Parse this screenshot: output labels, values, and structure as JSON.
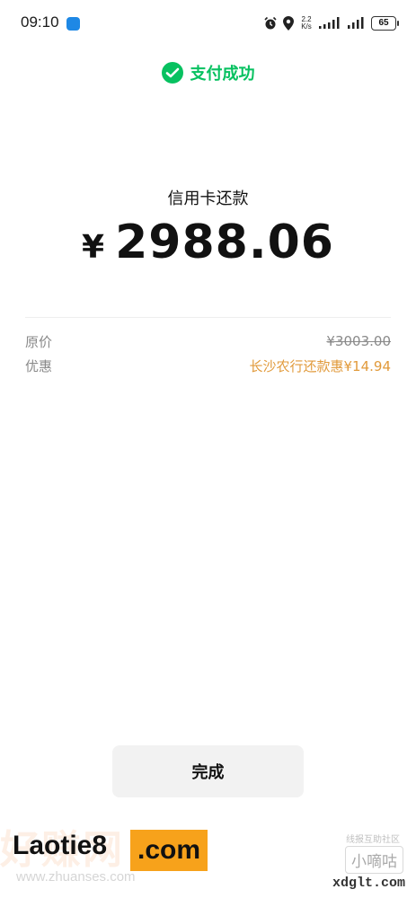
{
  "status": {
    "time": "09:10",
    "net_speed_value": "2.2",
    "net_speed_unit": "K/s",
    "battery": "65"
  },
  "payment": {
    "success_text": "支付成功",
    "title": "信用卡还款",
    "currency": "¥",
    "amount": "2988.06"
  },
  "details": [
    {
      "label": "原价",
      "value": "¥3003.00"
    },
    {
      "label": "优惠",
      "value": "长沙农行还款惠¥14.94"
    }
  ],
  "done_label": "完成",
  "watermarks": {
    "left_bg": "好赚网",
    "left_sub": "www.zhuanses.com",
    "laotie": "Laotie8",
    "com": ".com",
    "right_top": "线报互助社区",
    "right_mid": "小嘀咕",
    "right_bottom": "xdglt.com"
  },
  "colors": {
    "success_green": "#07c160",
    "discount_orange": "#e19a3b"
  },
  "icons": {
    "success": "wechat-pay-icon",
    "alarm": "alarm-icon",
    "location": "location-icon",
    "signal": "signal-icon"
  }
}
